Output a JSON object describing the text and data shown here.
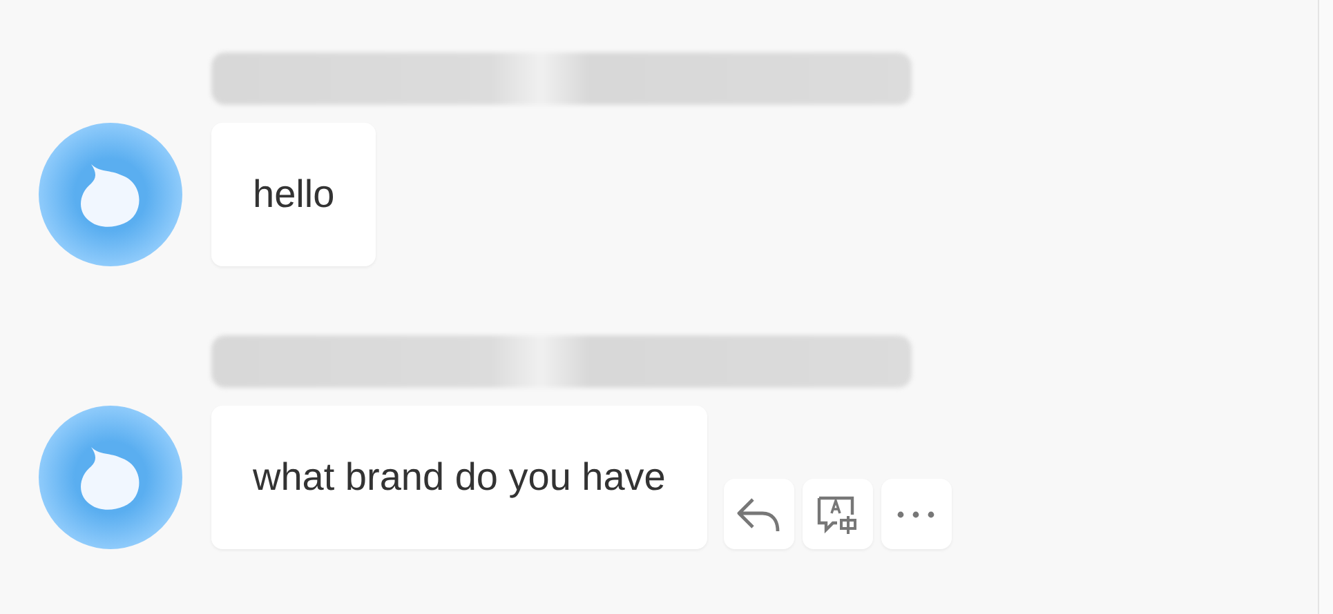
{
  "messages": [
    {
      "text": "hello"
    },
    {
      "text": "what brand do you have",
      "actions": [
        {
          "kind": "reply"
        },
        {
          "kind": "translate"
        },
        {
          "kind": "more"
        }
      ]
    }
  ]
}
